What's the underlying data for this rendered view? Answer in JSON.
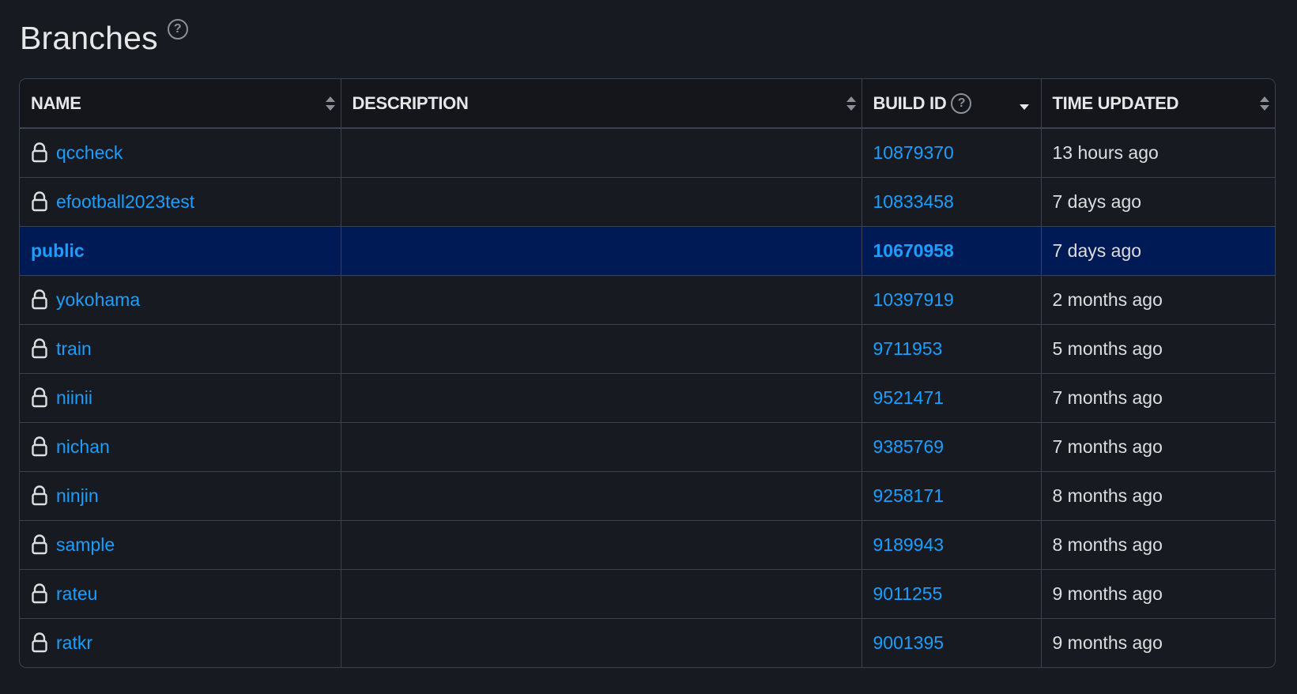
{
  "page": {
    "title": "Branches",
    "title_help_icon": "?"
  },
  "table": {
    "columns": [
      {
        "key": "name",
        "label": "NAME",
        "sort": "none"
      },
      {
        "key": "description",
        "label": "DESCRIPTION",
        "sort": "none"
      },
      {
        "key": "build_id",
        "label": "BUILD ID",
        "sort": "descending",
        "help_icon": "?"
      },
      {
        "key": "time_updated",
        "label": "TIME UPDATED",
        "sort": "none"
      }
    ],
    "rows": [
      {
        "name": "qccheck",
        "locked": true,
        "description": "",
        "build_id": "10879370",
        "time_updated": "13 hours ago",
        "selected": false
      },
      {
        "name": "efootball2023test",
        "locked": true,
        "description": "",
        "build_id": "10833458",
        "time_updated": "7 days ago",
        "selected": false
      },
      {
        "name": "public",
        "locked": false,
        "description": "",
        "build_id": "10670958",
        "time_updated": "7 days ago",
        "selected": true
      },
      {
        "name": "yokohama",
        "locked": true,
        "description": "",
        "build_id": "10397919",
        "time_updated": "2 months ago",
        "selected": false
      },
      {
        "name": "train",
        "locked": true,
        "description": "",
        "build_id": "9711953",
        "time_updated": "5 months ago",
        "selected": false
      },
      {
        "name": "niinii",
        "locked": true,
        "description": "",
        "build_id": "9521471",
        "time_updated": "7 months ago",
        "selected": false
      },
      {
        "name": "nichan",
        "locked": true,
        "description": "",
        "build_id": "9385769",
        "time_updated": "7 months ago",
        "selected": false
      },
      {
        "name": "ninjin",
        "locked": true,
        "description": "",
        "build_id": "9258171",
        "time_updated": "8 months ago",
        "selected": false
      },
      {
        "name": "sample",
        "locked": true,
        "description": "",
        "build_id": "9189943",
        "time_updated": "8 months ago",
        "selected": false
      },
      {
        "name": "rateu",
        "locked": true,
        "description": "",
        "build_id": "9011255",
        "time_updated": "9 months ago",
        "selected": false
      },
      {
        "name": "ratkr",
        "locked": true,
        "description": "",
        "build_id": "9001395",
        "time_updated": "9 months ago",
        "selected": false
      }
    ]
  },
  "icons": {
    "lock": "lock-icon",
    "sort_both": "sort-both-icon",
    "sort_desc": "sort-descending-icon",
    "help": "help-circle-icon"
  },
  "colors": {
    "background": "#171a21",
    "header_background": "#14161c",
    "border": "#3a4150",
    "link": "#1a9fff",
    "selected_row": "#001a55",
    "text": "#dcdedf",
    "icon_muted": "#8a8f98"
  }
}
